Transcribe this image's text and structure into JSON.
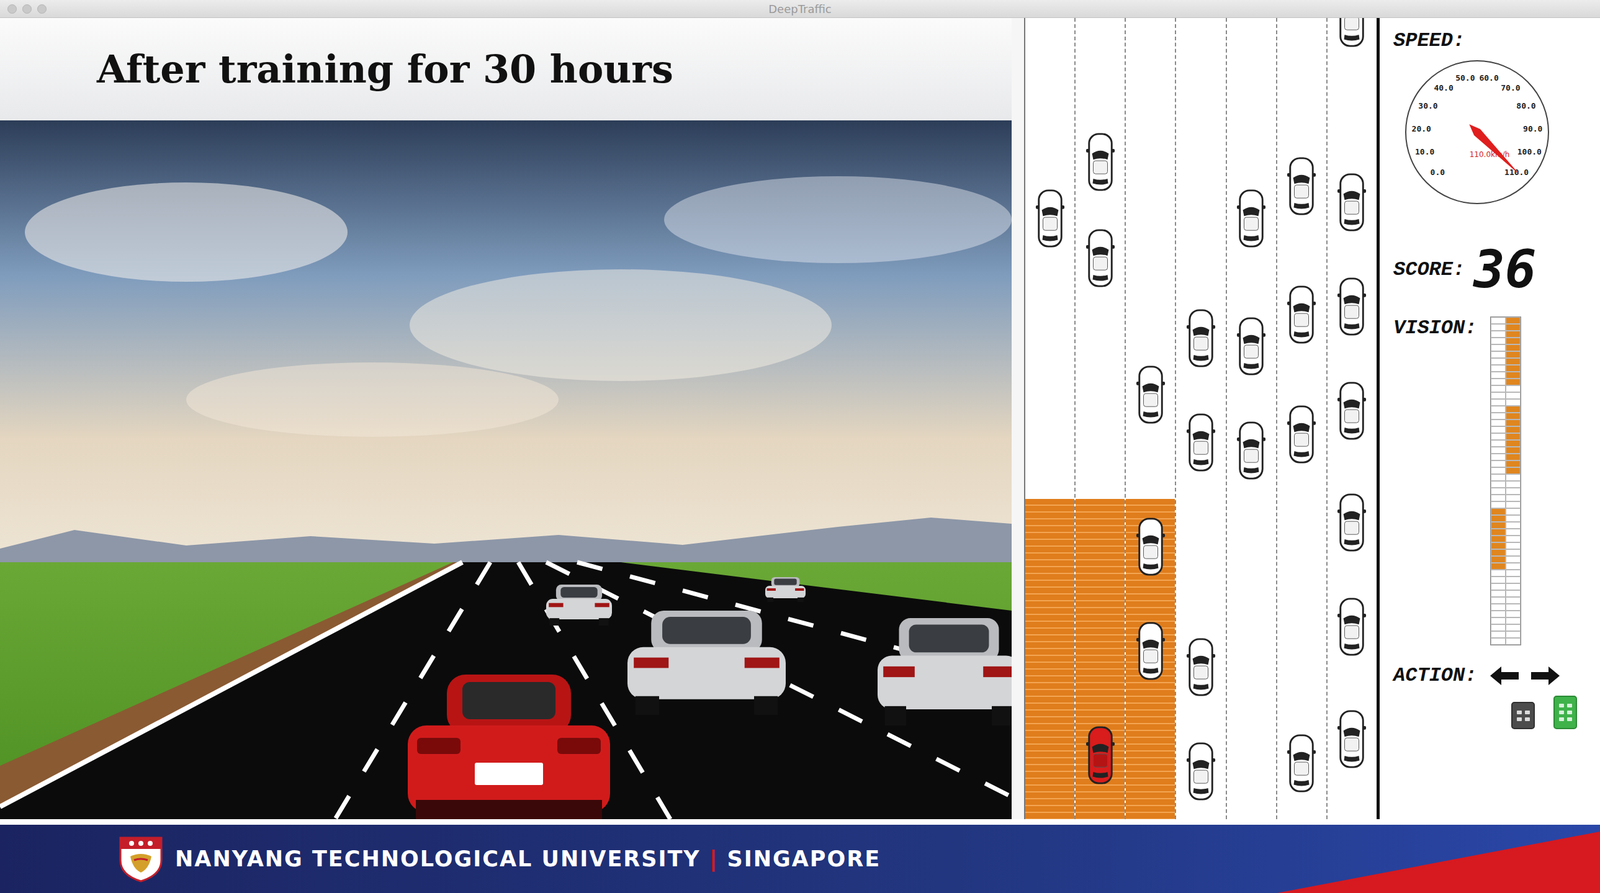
{
  "window": {
    "title": "DeepTraffic"
  },
  "slide": {
    "title": "After training for 30 hours"
  },
  "road": {
    "lanes": 7,
    "vision_area": {
      "first_lane": 0,
      "last_lane": 2,
      "start": 0.6
    },
    "cars": [
      {
        "lane": 0,
        "position": 0.25,
        "kind": "other"
      },
      {
        "lane": 1,
        "position": 0.18,
        "kind": "other"
      },
      {
        "lane": 1,
        "position": 0.3,
        "kind": "other"
      },
      {
        "lane": 2,
        "position": 0.47,
        "kind": "other"
      },
      {
        "lane": 2,
        "position": 0.66,
        "kind": "other"
      },
      {
        "lane": 2,
        "position": 0.79,
        "kind": "other"
      },
      {
        "lane": 3,
        "position": 0.4,
        "kind": "other"
      },
      {
        "lane": 3,
        "position": 0.53,
        "kind": "other"
      },
      {
        "lane": 3,
        "position": 0.81,
        "kind": "other"
      },
      {
        "lane": 3,
        "position": 0.94,
        "kind": "other"
      },
      {
        "lane": 4,
        "position": 0.25,
        "kind": "other"
      },
      {
        "lane": 4,
        "position": 0.41,
        "kind": "other"
      },
      {
        "lane": 4,
        "position": 0.54,
        "kind": "other"
      },
      {
        "lane": 5,
        "position": 0.21,
        "kind": "other"
      },
      {
        "lane": 5,
        "position": 0.37,
        "kind": "other"
      },
      {
        "lane": 5,
        "position": 0.52,
        "kind": "other"
      },
      {
        "lane": 5,
        "position": 0.93,
        "kind": "other"
      },
      {
        "lane": 6,
        "position": 0.0,
        "kind": "other"
      },
      {
        "lane": 6,
        "position": 0.23,
        "kind": "other"
      },
      {
        "lane": 6,
        "position": 0.36,
        "kind": "other"
      },
      {
        "lane": 6,
        "position": 0.49,
        "kind": "other"
      },
      {
        "lane": 6,
        "position": 0.63,
        "kind": "other"
      },
      {
        "lane": 6,
        "position": 0.76,
        "kind": "other"
      },
      {
        "lane": 6,
        "position": 0.9,
        "kind": "other"
      },
      {
        "lane": 1,
        "position": 0.92,
        "kind": "agent"
      }
    ]
  },
  "stats": {
    "speed": {
      "label": "SPEED:",
      "ticks": [
        "0.0",
        "10.0",
        "20.0",
        "30.0",
        "40.0",
        "50.0",
        "60.0",
        "70.0",
        "80.0",
        "90.0",
        "100.0",
        "110.0"
      ],
      "reading": "110.0km/h",
      "level": 1.0
    },
    "score": {
      "label": "SCORE:",
      "value": "36"
    },
    "vision": {
      "label": "VISION:",
      "segments": [
        {
          "column": 1,
          "from": 0.01,
          "to": 0.2
        },
        {
          "column": 1,
          "from": 0.28,
          "to": 0.47
        },
        {
          "column": 0,
          "from": 0.58,
          "to": 0.77
        }
      ]
    },
    "action": {
      "label": "ACTION:",
      "pedals": [
        {
          "name": "brake",
          "selected": false
        },
        {
          "name": "accelerate",
          "selected": true
        }
      ]
    }
  },
  "footer": {
    "name": "NANYANG TECHNOLOGICAL UNIVERSITY",
    "separator": "|",
    "place": "SINGAPORE"
  }
}
